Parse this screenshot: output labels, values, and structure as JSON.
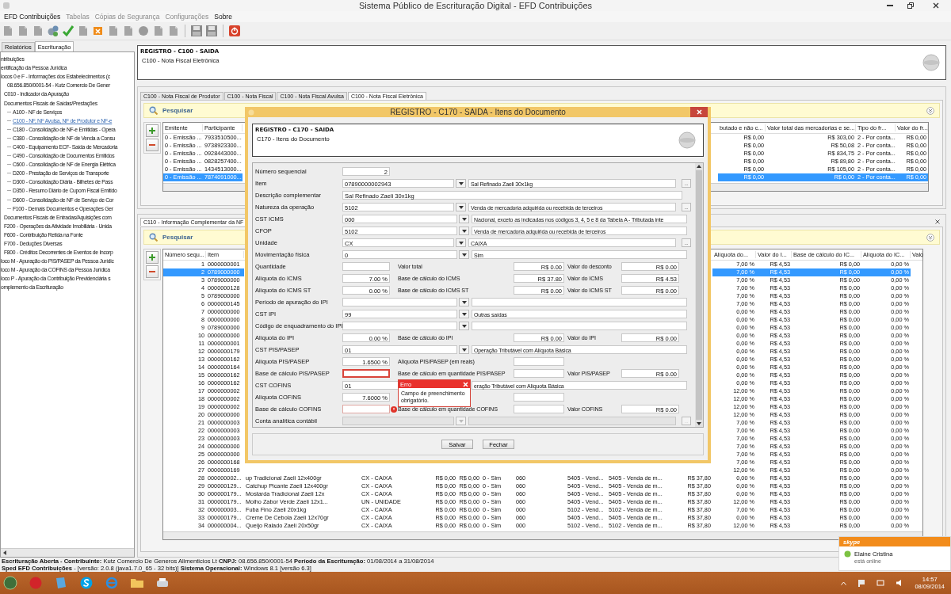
{
  "window": {
    "title": "Sistema Público de Escrituração Digital - EFD Contribuições"
  },
  "menu": [
    {
      "label": "EFD Contribuições",
      "disabled": false
    },
    {
      "label": "Tabelas",
      "disabled": true
    },
    {
      "label": "Cópias de Segurança",
      "disabled": true
    },
    {
      "label": "Configurações",
      "disabled": true
    },
    {
      "label": "Sobre",
      "disabled": false
    }
  ],
  "sidebar": {
    "tabs": [
      {
        "label": "Relatórios",
        "selected": false
      },
      {
        "label": "Escrituração",
        "selected": true
      }
    ],
    "tree": [
      {
        "label": "ntribuições",
        "selected": false,
        "children": [
          {
            "label": "entificação da Pessoa Jurídica",
            "selected": false
          },
          {
            "label": "locos 0 e F - Informações dos Estabelecimentos (c",
            "selected": false,
            "children": [
              {
                "label": "08.656.850/0001-54  -  Kutz Comercio De Gener",
                "selected": false,
                "children": [
                  {
                    "label": "C010 - Indicador da Apuração",
                    "selected": false
                  },
                  {
                    "label": "Documentos Fiscais de Saídas/Prestações",
                    "selected": false,
                    "children": [
                      {
                        "label": "A100 - NF de Serviços",
                        "selected": false
                      },
                      {
                        "label": "C100 - NF, NF Avulsa, NF de Produtor e NF-e",
                        "selected": true
                      },
                      {
                        "label": "C180 - Consolidação de NF-e Emitidas - Opera",
                        "selected": false
                      },
                      {
                        "label": "C380 - Consolidação de NF de Venda a Consu",
                        "selected": false
                      },
                      {
                        "label": "C400 - Equipamento ECF- Saída de Mercadoria",
                        "selected": false
                      },
                      {
                        "label": "C490 - Consolidação de Documentos Emitidos",
                        "selected": false
                      },
                      {
                        "label": "C600 - Consolidação de NF de Energia Elétrica",
                        "selected": false
                      },
                      {
                        "label": "D200 - Prestação de Serviços de Transporte",
                        "selected": false
                      },
                      {
                        "label": "D300 - Consolidação Diária - Bilhetes de Pass",
                        "selected": false
                      },
                      {
                        "label": "D350 - Resumo Diário de Cupom Fiscal Emitido",
                        "selected": false
                      },
                      {
                        "label": "D600 - Consolidação de NF de Serviço de Cor",
                        "selected": false
                      },
                      {
                        "label": "F100 - Demais Documentos e Operações Ger",
                        "selected": false
                      }
                    ]
                  },
                  {
                    "label": "Documentos Fiscais de Entradas/Aquisições com",
                    "selected": false
                  },
                  {
                    "label": "F200 - Operações da Atividade Imobiliária - Unida",
                    "selected": false
                  },
                  {
                    "label": "F600 - Contribuição Retida na Fonte",
                    "selected": false
                  },
                  {
                    "label": "F700 - Deduções Diversas",
                    "selected": false
                  },
                  {
                    "label": "F800 - Créditos Decorrentes de Eventos de Incorp",
                    "selected": false
                  }
                ]
              }
            ]
          },
          {
            "label": "loco M - Apuração do PIS/PASEP da Pessoa Jurídic",
            "selected": false
          },
          {
            "label": "loco M - Apuração da COFINS da Pessoa Jurídica",
            "selected": false
          },
          {
            "label": "loco P - Apuração da Contribuição Previdenciária s",
            "selected": false
          },
          {
            "label": "omplemento da Escrituração",
            "selected": false
          }
        ]
      }
    ]
  },
  "header": {
    "title": "REGISTRO - C100 - SAIDA",
    "subtitle": "C100 - Nota Fiscal Eletrônica"
  },
  "tabs": [
    {
      "label": "C100 - Nota Fiscal de Produtor",
      "selected": false
    },
    {
      "label": "C100 - Nota Fiscal",
      "selected": false
    },
    {
      "label": "C100 - Nota Fiscal Avulsa",
      "selected": false
    },
    {
      "label": "C100 - Nota Fiscal Eletrônica",
      "selected": true
    }
  ],
  "top_panel": {
    "search": "Pesquisar",
    "columns": [
      "Emitente",
      "Participante",
      null,
      "butado e não c...",
      "Valor total das mercadorias e se...",
      "Tipo do fr...",
      "Valor do fr..."
    ],
    "rows": [
      {
        "selected": false,
        "cells": [
          "0 - Emissão ...",
          "7933510500...",
          null,
          "R$ 0,00",
          "R$ 303,00",
          "2 - Por conta...",
          "R$ 0,00"
        ]
      },
      {
        "selected": false,
        "cells": [
          "0 - Emissão ...",
          "9738923300...",
          null,
          "R$ 0,00",
          "R$ 50,08",
          "2 - Por conta...",
          "R$ 0,00"
        ]
      },
      {
        "selected": false,
        "cells": [
          "0 - Emissão ...",
          "0928443000...",
          null,
          "R$ 0,00",
          "R$ 834,75",
          "2 - Por conta...",
          "R$ 0,00"
        ]
      },
      {
        "selected": false,
        "cells": [
          "0 - Emissão ...",
          "0828257400...",
          null,
          "R$ 0,00",
          "R$ 89,80",
          "2 - Por conta...",
          "R$ 0,00"
        ]
      },
      {
        "selected": false,
        "cells": [
          "0 - Emissão ...",
          "1434513000...",
          null,
          "R$ 0,00",
          "R$ 105,00",
          "2 - Por conta...",
          "R$ 0,00"
        ]
      },
      {
        "selected": true,
        "cells": [
          "0 - Emissão ...",
          "7874091000...",
          null,
          "R$ 0,00",
          "R$ 0,00",
          "2 - Por conta...",
          "R$ 0,00"
        ]
      }
    ]
  },
  "bottom_panel": {
    "tab": "C110 - Informação Complementar da NF",
    "search": "Pesquisar",
    "columns": [
      "Número sequ...",
      "Item",
      null,
      null,
      null,
      null,
      null,
      null,
      null,
      null,
      null,
      "Alíquota do...",
      "Valor do I...",
      "Base de cálculo do IC...",
      "Alíquota do IC...",
      "Valo"
    ],
    "rows": [
      {
        "selected": false,
        "cells": [
          "1",
          "0000000001",
          null,
          null,
          null,
          null,
          null,
          null,
          null,
          null,
          null,
          "7,00 %",
          "R$ 4,53",
          "R$ 0,00",
          "0,00 %"
        ]
      },
      {
        "selected": true,
        "cells": [
          "2",
          "0789000000",
          null,
          null,
          null,
          null,
          null,
          null,
          null,
          null,
          null,
          "7,00 %",
          "R$ 4,53",
          "R$ 0,00",
          "0,00 %"
        ]
      },
      {
        "selected": false,
        "cells": [
          "3",
          "0789000000",
          null,
          null,
          null,
          null,
          null,
          null,
          null,
          null,
          null,
          "7,00 %",
          "R$ 4,53",
          "R$ 0,00",
          "0,00 %"
        ]
      },
      {
        "selected": false,
        "cells": [
          "4",
          "0000000128",
          null,
          null,
          null,
          null,
          null,
          null,
          null,
          null,
          null,
          "7,00 %",
          "R$ 4,53",
          "R$ 0,00",
          "0,00 %"
        ]
      },
      {
        "selected": false,
        "cells": [
          "5",
          "0789000000",
          null,
          null,
          null,
          null,
          null,
          null,
          null,
          null,
          null,
          "7,00 %",
          "R$ 4,53",
          "R$ 0,00",
          "0,00 %"
        ]
      },
      {
        "selected": false,
        "cells": [
          "6",
          "0000000145",
          null,
          null,
          null,
          null,
          null,
          null,
          null,
          null,
          null,
          "7,00 %",
          "R$ 4,53",
          "R$ 0,00",
          "0,00 %"
        ]
      },
      {
        "selected": false,
        "cells": [
          "7",
          "0000000000",
          null,
          null,
          null,
          null,
          null,
          null,
          null,
          null,
          null,
          "0,00 %",
          "R$ 4,53",
          "R$ 0,00",
          "0,00 %"
        ]
      },
      {
        "selected": false,
        "cells": [
          "8",
          "0000000000",
          null,
          null,
          null,
          null,
          null,
          null,
          null,
          null,
          null,
          "0,00 %",
          "R$ 4,53",
          "R$ 0,00",
          "0,00 %"
        ]
      },
      {
        "selected": false,
        "cells": [
          "9",
          "0789000000",
          null,
          null,
          null,
          null,
          null,
          null,
          null,
          null,
          null,
          "0,00 %",
          "R$ 4,53",
          "R$ 0,00",
          "0,00 %"
        ]
      },
      {
        "selected": false,
        "cells": [
          "10",
          "0000000000",
          null,
          null,
          null,
          null,
          null,
          null,
          null,
          null,
          null,
          "0,00 %",
          "R$ 4,53",
          "R$ 0,00",
          "0,00 %"
        ]
      },
      {
        "selected": false,
        "cells": [
          "11",
          "0000000001",
          null,
          null,
          null,
          null,
          null,
          null,
          null,
          null,
          null,
          "0,00 %",
          "R$ 4,53",
          "R$ 0,00",
          "0,00 %"
        ]
      },
      {
        "selected": false,
        "cells": [
          "12",
          "0000000179",
          null,
          null,
          null,
          null,
          null,
          null,
          null,
          null,
          null,
          "0,00 %",
          "R$ 4,53",
          "R$ 0,00",
          "0,00 %"
        ]
      },
      {
        "selected": false,
        "cells": [
          "13",
          "0000000162",
          null,
          null,
          null,
          null,
          null,
          null,
          null,
          null,
          null,
          "0,00 %",
          "R$ 4,53",
          "R$ 0,00",
          "0,00 %"
        ]
      },
      {
        "selected": false,
        "cells": [
          "14",
          "0000000164",
          null,
          null,
          null,
          null,
          null,
          null,
          null,
          null,
          null,
          "0,00 %",
          "R$ 4,53",
          "R$ 0,00",
          "0,00 %"
        ]
      },
      {
        "selected": false,
        "cells": [
          "15",
          "0000000162",
          null,
          null,
          null,
          null,
          null,
          null,
          null,
          null,
          null,
          "0,00 %",
          "R$ 4,53",
          "R$ 0,00",
          "0,00 %"
        ]
      },
      {
        "selected": false,
        "cells": [
          "16",
          "0000000162",
          null,
          null,
          null,
          null,
          null,
          null,
          null,
          null,
          null,
          "0,00 %",
          "R$ 4,53",
          "R$ 0,00",
          "0,00 %"
        ]
      },
      {
        "selected": false,
        "cells": [
          "17",
          "0000000002",
          null,
          null,
          null,
          null,
          null,
          null,
          null,
          null,
          null,
          "12,00 %",
          "R$ 4,53",
          "R$ 0,00",
          "0,00 %"
        ]
      },
      {
        "selected": false,
        "cells": [
          "18",
          "0000000002",
          null,
          null,
          null,
          null,
          null,
          null,
          null,
          null,
          null,
          "12,00 %",
          "R$ 4,53",
          "R$ 0,00",
          "0,00 %"
        ]
      },
      {
        "selected": false,
        "cells": [
          "19",
          "0000000002",
          null,
          null,
          null,
          null,
          null,
          null,
          null,
          null,
          null,
          "12,00 %",
          "R$ 4,53",
          "R$ 0,00",
          "0,00 %"
        ]
      },
      {
        "selected": false,
        "cells": [
          "20",
          "0000000000",
          null,
          null,
          null,
          null,
          null,
          null,
          null,
          null,
          null,
          "12,00 %",
          "R$ 4,53",
          "R$ 0,00",
          "0,00 %"
        ]
      },
      {
        "selected": false,
        "cells": [
          "21",
          "0000000003",
          null,
          null,
          null,
          null,
          null,
          null,
          null,
          null,
          null,
          "7,00 %",
          "R$ 4,53",
          "R$ 0,00",
          "0,00 %"
        ]
      },
      {
        "selected": false,
        "cells": [
          "22",
          "0000000003",
          null,
          null,
          null,
          null,
          null,
          null,
          null,
          null,
          null,
          "7,00 %",
          "R$ 4,53",
          "R$ 0,00",
          "0,00 %"
        ]
      },
      {
        "selected": false,
        "cells": [
          "23",
          "0000000003",
          null,
          null,
          null,
          null,
          null,
          null,
          null,
          null,
          null,
          "7,00 %",
          "R$ 4,53",
          "R$ 0,00",
          "0,00 %"
        ]
      },
      {
        "selected": false,
        "cells": [
          "24",
          "0000000000",
          null,
          null,
          null,
          null,
          null,
          null,
          null,
          null,
          null,
          "7,00 %",
          "R$ 4,53",
          "R$ 0,00",
          "0,00 %"
        ]
      },
      {
        "selected": false,
        "cells": [
          "25",
          "0000000000",
          null,
          null,
          null,
          null,
          null,
          null,
          null,
          null,
          null,
          "7,00 %",
          "R$ 4,53",
          "R$ 0,00",
          "0,00 %"
        ]
      },
      {
        "selected": false,
        "cells": [
          "26",
          "0000000168",
          null,
          null,
          null,
          null,
          null,
          null,
          null,
          null,
          null,
          "7,00 %",
          "R$ 4,53",
          "R$ 0,00",
          "0,00 %"
        ]
      },
      {
        "selected": false,
        "cells": [
          "27",
          "0000000169",
          null,
          null,
          null,
          null,
          null,
          null,
          null,
          null,
          null,
          "12,00 %",
          "R$ 4,53",
          "R$ 0,00",
          "0,00 %"
        ]
      },
      {
        "selected": false,
        "cells": [
          "28",
          "000000002...",
          "up Tradicional Zaeli 12x400gr",
          "CX - CAIXA",
          "R$ 0,00",
          "R$ 0,00",
          "0 - Sim",
          "060",
          "5405 - Vend...",
          "5405 - Venda de m...",
          "R$ 37,80",
          "0,00 %",
          "R$ 4,53",
          "R$ 0,00",
          "0,00 %"
        ]
      },
      {
        "selected": false,
        "cells": [
          "29",
          "000000129...",
          "Catchup Picante Zaeli 12x400gr",
          "CX - CAIXA",
          "R$ 0,00",
          "R$ 0,00",
          "0 - Sim",
          "060",
          "5405 - Vend...",
          "5405 - Venda de m...",
          "R$ 37,80",
          "0,00 %",
          "R$ 4,53",
          "R$ 0,00",
          "0,00 %"
        ]
      },
      {
        "selected": false,
        "cells": [
          "30",
          "000000179...",
          "Mostarda Tradicional Zaeli 12x",
          "CX - CAIXA",
          "R$ 0,00",
          "R$ 0,00",
          "0 - Sim",
          "060",
          "5405 - Vend...",
          "5405 - Venda de m...",
          "R$ 37,80",
          "0,00 %",
          "R$ 4,53",
          "R$ 0,00",
          "0,00 %"
        ]
      },
      {
        "selected": false,
        "cells": [
          "31",
          "000000179...",
          "Molho Zabor Verde Zaeli 12x1...",
          "UN - UNIDADE",
          "R$ 0,00",
          "R$ 0,00",
          "0 - Sim",
          "060",
          "5405 - Vend...",
          "5405 - Venda de m...",
          "R$ 37,80",
          "12,00 %",
          "R$ 4,53",
          "R$ 0,00",
          "0,00 %"
        ]
      },
      {
        "selected": false,
        "cells": [
          "32",
          "000000003...",
          "Fuba Fino Zaeli 20x1kg",
          "CX - CAIXA",
          "R$ 0,00",
          "R$ 0,00",
          "0 - Sim",
          "000",
          "5102 - Vend...",
          "5102 - Venda de m...",
          "R$ 37,80",
          "7,00 %",
          "R$ 4,53",
          "R$ 0,00",
          "0,00 %"
        ]
      },
      {
        "selected": false,
        "cells": [
          "33",
          "000000179...",
          "Creme De Cebola Zaeli 12x70gr",
          "CX - CAIXA",
          "R$ 0,00",
          "R$ 0,00",
          "0 - Sim",
          "060",
          "5405 - Vend...",
          "5405 - Venda de m...",
          "R$ 37,80",
          "0,00 %",
          "R$ 4,53",
          "R$ 0,00",
          "0,00 %"
        ]
      },
      {
        "selected": false,
        "cells": [
          "34",
          "000000004...",
          "Queijo Ralado Zaeli 20x50gr",
          "CX - CAIXA",
          "R$ 0,00",
          "R$ 0,00",
          "0 - Sim",
          "000",
          "5102 - Vend...",
          "5102 - Venda de m...",
          "R$ 37,80",
          "12,00 %",
          "R$ 4,53",
          "R$ 0,00",
          "0,00 %"
        ]
      }
    ]
  },
  "dialog": {
    "title": "REGISTRO - C170 - SAIDA - Itens do Documento",
    "heading": "REGISTRO - C170 - SAIDA",
    "subheading": "C170 - Itens do Documento",
    "form": [
      {
        "kind": "number",
        "label": "Número sequencial",
        "value": "2"
      },
      {
        "kind": "lookup",
        "label": "Item",
        "code": "07890000002943",
        "description": "Sal Refinado Zaeli 30x1kg",
        "more_button": "...",
        "disabled": false
      },
      {
        "kind": "text",
        "label": "Descrição complementar",
        "value": "Sal Refinado Zaeli 30x1kg"
      },
      {
        "kind": "lookup",
        "label": "Natureza da operação",
        "code": "5102",
        "description": "Venda de mercadoria adquirida ou recebida de terceiros",
        "more_button": "...",
        "disabled": false
      },
      {
        "kind": "lookup",
        "label": "CST ICMS",
        "code": "000",
        "description": "Nacional, exceto as indicadas nos códigos 3, 4, 5 e 8 da Tabela A - Tributada inte",
        "disabled": false
      },
      {
        "kind": "lookup",
        "label": "CFOP",
        "code": "5102",
        "description": "Venda de mercadoria adquirida ou recebida de terceiros",
        "disabled": false
      },
      {
        "kind": "lookup",
        "label": "Unidade",
        "code": "CX",
        "description": "CAIXA",
        "more_button": "...",
        "disabled": false
      },
      {
        "kind": "lookup",
        "label": "Movimentação física",
        "code": "0",
        "description": "Sim",
        "disabled": false
      },
      {
        "kind": "values",
        "label": "Quantidade",
        "fields": [
          {
            "invalid": false,
            "focused": false
          },
          {
            "label": "Valor total",
            "value": "R$ 0.00",
            "invalid": false,
            "focused": false
          },
          {
            "label": "Valor do desconto",
            "value": "R$ 0.00",
            "invalid": false,
            "focused": false
          }
        ]
      },
      {
        "kind": "values",
        "label": "Alíquota do ICMS",
        "fields": [
          {
            "value": "7.00 %",
            "invalid": false,
            "focused": false
          },
          {
            "label": "Base de cálculo do ICMS",
            "value": "R$ 37.80",
            "invalid": false,
            "focused": false
          },
          {
            "label": "Valor do ICMS",
            "value": "R$ 4.53",
            "invalid": false,
            "focused": false
          }
        ]
      },
      {
        "kind": "values",
        "label": "Alíquota do ICMS ST",
        "fields": [
          {
            "value": "0.00 %",
            "invalid": false,
            "focused": false
          },
          {
            "label": "Base de cálculo do ICMS ST",
            "value": "R$ 0.00",
            "invalid": false,
            "focused": false
          },
          {
            "label": "Valor do ICMS ST",
            "value": "R$ 0.00",
            "invalid": false,
            "focused": false
          }
        ]
      },
      {
        "kind": "lookup",
        "label": "Período de apuração do IPI",
        "disabled": false
      },
      {
        "kind": "lookup",
        "label": "CST IPI",
        "code": "99",
        "description": "Outras saídas",
        "disabled": false
      },
      {
        "kind": "lookup",
        "label": "Código de enquadramento do IPI",
        "disabled": false
      },
      {
        "kind": "values",
        "label": "Alíquota do IPI",
        "fields": [
          {
            "value": "0.00 %",
            "invalid": false,
            "focused": false
          },
          {
            "label": "Base de cálculo do IPI",
            "value": "R$ 0.00",
            "invalid": false,
            "focused": false
          },
          {
            "label": "Valor do IPI",
            "value": "R$ 0.00",
            "invalid": false,
            "focused": false
          }
        ]
      },
      {
        "kind": "lookup",
        "label": "CST PIS/PASEP",
        "code": "01",
        "description": "Operação Tributável com Alíquota Básica",
        "disabled": false
      },
      {
        "kind": "values",
        "label": "Alíquota PIS/PASEP",
        "fields": [
          {
            "value": "1.6500 %",
            "invalid": false,
            "focused": false
          },
          {
            "label": "Alíquota PIS/PASEP (em reais)",
            "invalid": false,
            "focused": false
          }
        ]
      },
      {
        "kind": "values",
        "label": "Base de cálculo PIS/PASEP",
        "fields": [
          {
            "invalid": true,
            "focused": true
          },
          {
            "label": "Base de cálculo em quantidade PIS/PASEP",
            "invalid": false,
            "focused": false
          },
          {
            "label": "Valor PIS/PASEP",
            "value": "R$ 0.00",
            "invalid": false,
            "focused": false
          }
        ]
      },
      {
        "kind": "lookup",
        "label": "CST COFINS",
        "code": "01",
        "description": "eração Tributável com Alíquota Básica",
        "disabled": false
      },
      {
        "kind": "values",
        "label": "Alíquota COFINS",
        "fields": [
          {
            "value": "7.6000 %",
            "invalid": false,
            "focused": false
          },
          {
            "invalid": false,
            "focused": false
          }
        ]
      },
      {
        "kind": "values",
        "label": "Base de cálculo COFINS",
        "fields": [
          {
            "invalid": true,
            "focused": false
          },
          {
            "label": "Base de cálculo em quantidade COFINS",
            "invalid": false,
            "focused": false
          },
          {
            "label": "Valor COFINS",
            "value": "R$ 0.00",
            "invalid": false,
            "focused": false
          }
        ]
      },
      {
        "kind": "lookup",
        "label": "Conta analítica contábil",
        "more_button": "...",
        "disabled": true
      }
    ],
    "error_popup": {
      "title": "Erro",
      "message": "Campo de preenchimento obrigatório."
    },
    "buttons": [
      "Salvar",
      "Fechar"
    ]
  },
  "status_bar": [
    "**Escrituração Aberta - Contribuinte:** Kutz Comercio De Generos Alimenticios Lt **CNPJ:** 08.656.850/0001-54 **Período da Escrituração:** 01/08/2014 a 31/08/2014",
    "**Sped EFD Contribuições** - [versão: 2.0.8 (java1.7.0_65 - 32 bits)] **Sistema Operacional:** Windows 8.1 [versão 6.3]"
  ],
  "notification": {
    "brand": "skype",
    "contact": "Elaine Cristina",
    "status": "está online"
  },
  "clock": {
    "time": "14:57",
    "date": "08/09/2014"
  }
}
